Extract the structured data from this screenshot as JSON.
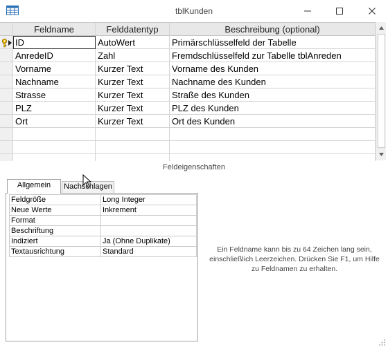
{
  "window": {
    "title": "tblKunden",
    "icon": "table-icon",
    "controls": [
      "minimize-icon",
      "maximize-icon",
      "close-icon"
    ]
  },
  "grid": {
    "columns": [
      "Feldname",
      "Felddatentyp",
      "Beschreibung (optional)"
    ],
    "rows": [
      {
        "name": "ID",
        "type": "AutoWert",
        "description": "Primärschlüsselfeld der Tabelle",
        "primary_key": true
      },
      {
        "name": "AnredeID",
        "type": "Zahl",
        "description": "Fremdschlüsselfeld zur Tabelle tblAnreden"
      },
      {
        "name": "Vorname",
        "type": "Kurzer Text",
        "description": "Vorname des Kunden"
      },
      {
        "name": "Nachname",
        "type": "Kurzer Text",
        "description": "Nachname des Kunden"
      },
      {
        "name": "Strasse",
        "type": "Kurzer Text",
        "description": "Straße des Kunden"
      },
      {
        "name": "PLZ",
        "type": "Kurzer Text",
        "description": "PLZ des Kunden"
      },
      {
        "name": "Ort",
        "type": "Kurzer Text",
        "description": "Ort des Kunden"
      }
    ]
  },
  "field_properties": {
    "section_label": "Feldeigenschaften",
    "tabs": [
      "Allgemein",
      "Nachschlagen"
    ],
    "active_tab": "Allgemein",
    "properties": [
      {
        "name": "Feldgröße",
        "value": "Long Integer"
      },
      {
        "name": "Neue Werte",
        "value": "Inkrement"
      },
      {
        "name": "Format",
        "value": ""
      },
      {
        "name": "Beschriftung",
        "value": ""
      },
      {
        "name": "Indiziert",
        "value": "Ja (Ohne Duplikate)"
      },
      {
        "name": "Textausrichtung",
        "value": "Standard"
      }
    ],
    "help_text": "Ein Feldname kann bis zu 64 Zeichen lang sein, einschließlich Leerzeichen. Drücken Sie F1, um Hilfe zu Feldnamen zu erhalten."
  },
  "colors": {
    "key_icon": "#d6a300",
    "header_bg": "#e8e8e8",
    "selector_bg": "#f0f0f0",
    "grid_line": "#d4d4d4"
  }
}
